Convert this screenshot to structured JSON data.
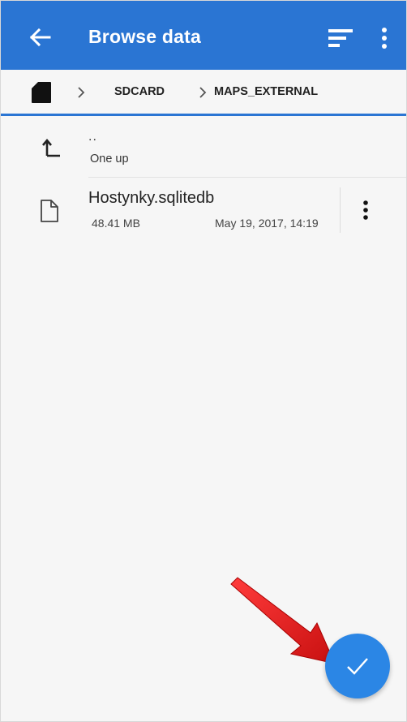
{
  "app_bar": {
    "title": "Browse data",
    "back_icon": "arrow-left-icon",
    "sort_icon": "sort-icon",
    "overflow_icon": "more-vert-icon",
    "background": "#2a75d3"
  },
  "breadcrumb": {
    "root_icon": "sd-card-icon",
    "items": [
      {
        "label": "SDCARD"
      },
      {
        "label": "MAPS_EXTERNAL"
      }
    ]
  },
  "list": {
    "up": {
      "label": "..",
      "sublabel": "One up",
      "icon": "level-up-icon"
    },
    "files": [
      {
        "name": "Hostynky.sqlitedb",
        "size": "48.41 MB",
        "date": "May 19, 2017, 14:19",
        "icon": "file-icon",
        "menu_icon": "more-vert-icon"
      }
    ]
  },
  "fab": {
    "icon": "check-icon",
    "color": "#2b86e5"
  },
  "annotation": {
    "icon": "red-arrow-icon",
    "color": "#e02020"
  }
}
